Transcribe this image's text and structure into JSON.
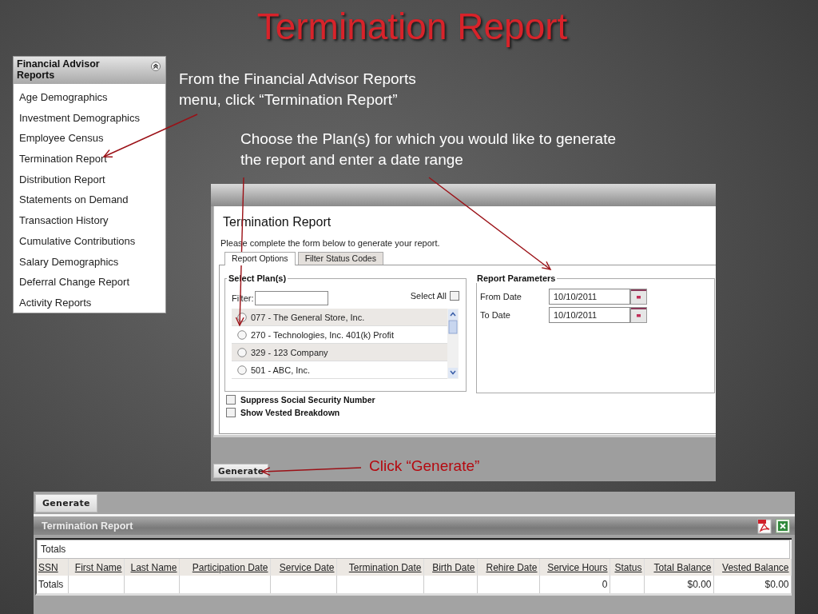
{
  "slide": {
    "title": "Termination Report"
  },
  "menu": {
    "title": "Financial Advisor Reports",
    "items": [
      {
        "label": "Age Demographics"
      },
      {
        "label": "Investment Demographics"
      },
      {
        "label": "Employee Census"
      },
      {
        "label": "Termination Report"
      },
      {
        "label": "Distribution Report"
      },
      {
        "label": "Statements on Demand"
      },
      {
        "label": "Transaction History"
      },
      {
        "label": "Cumulative Contributions"
      },
      {
        "label": "Salary Demographics"
      },
      {
        "label": "Deferral Change Report"
      },
      {
        "label": "Activity Reports"
      }
    ]
  },
  "callouts": [
    {
      "kind": "note",
      "lines": [
        "From the Financial Advisor Reports",
        "menu, click “Termination Report”"
      ]
    },
    {
      "kind": "note",
      "lines": [
        "Choose the Plan(s) for which you would like to generate",
        "the report and enter a date range"
      ]
    },
    {
      "kind": "accent",
      "lines": [
        "Click “Generate”"
      ]
    }
  ],
  "form": {
    "title": "Termination Report",
    "instructions": "Please complete the form below to generate your report.",
    "tabs": [
      {
        "label": "Report Options",
        "selected": true
      },
      {
        "label": "Filter Status Codes",
        "selected": false
      }
    ],
    "plans": {
      "legend": "Select Plan(s)",
      "filter_label": "Filter:",
      "select_all": {
        "label": "Select All",
        "checked": false
      },
      "items": [
        {
          "label": "077 - The General Store, Inc.",
          "selected": false
        },
        {
          "label": "270 - Technologies, Inc. 401(k) Profit",
          "selected": false
        },
        {
          "label": "329 -  123 Company",
          "selected": false
        },
        {
          "label": "501 -  ABC, Inc.",
          "selected": false
        }
      ]
    },
    "options": [
      {
        "label": "Suppress Social Security Number",
        "checked": false
      },
      {
        "label": "Show Vested Breakdown",
        "checked": false
      }
    ],
    "parameters": {
      "legend": "Report Parameters",
      "fields": [
        {
          "label": "From Date",
          "value": "10/10/2011"
        },
        {
          "label": "To Date",
          "value": "10/10/2011"
        }
      ]
    },
    "generate_button": "Generate"
  },
  "results": {
    "generate_button": "Generate",
    "title": "Termination Report",
    "totals_label": "Totals",
    "columns": [
      "SSN",
      "First Name",
      "Last Name",
      "Participation Date",
      "Service Date",
      "Termination Date",
      "Birth Date",
      "Rehire Date",
      "Service Hours",
      "Status",
      "Total Balance",
      "Vested Balance"
    ],
    "rows": [
      [
        "Totals",
        "",
        "",
        "",
        "",
        "",
        "",
        "",
        "0",
        "",
        "$0.00",
        "$0.00"
      ]
    ]
  }
}
